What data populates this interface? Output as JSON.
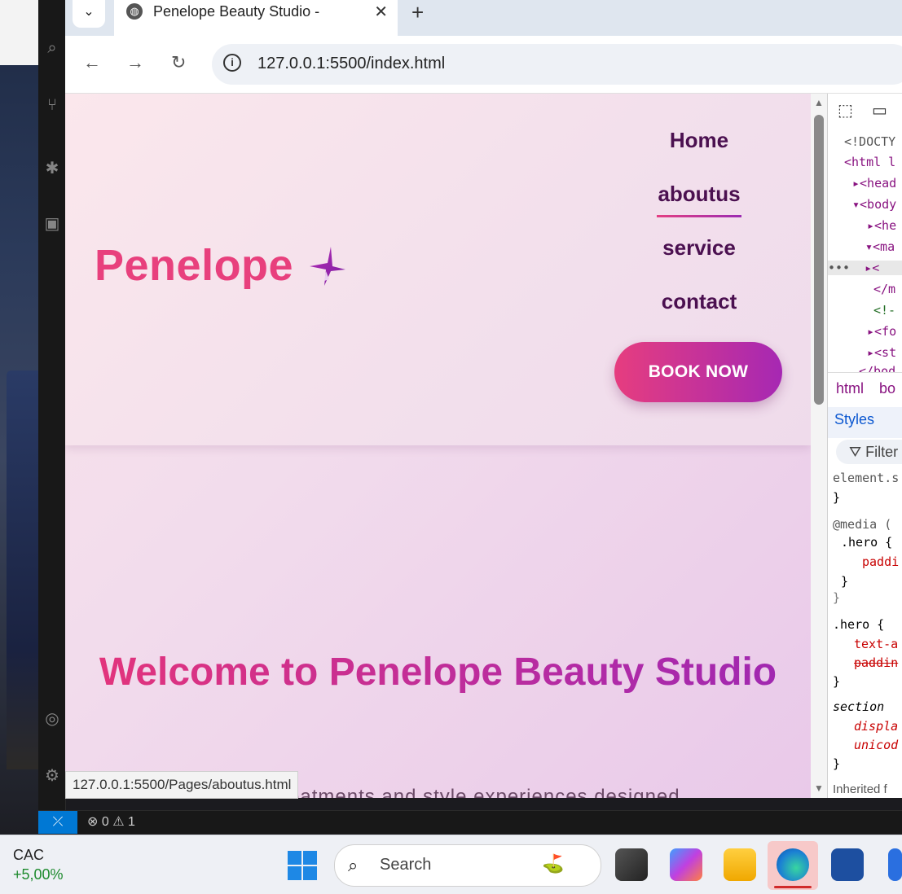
{
  "browser": {
    "tab_title": "Penelope Beauty Studio - Home",
    "url": "127.0.0.1:5500/index.html",
    "hover_link": "127.0.0.1:5500/Pages/aboutus.html"
  },
  "site": {
    "logo": "Penelope",
    "nav": [
      "Home",
      "aboutus",
      "service",
      "contact"
    ],
    "active_nav": "aboutus",
    "book_button": "BOOK NOW",
    "hero_title": "Welcome to Penelope Beauty Studio",
    "hero_text_partial": "...ntreatments and style experiences designed..."
  },
  "devtools": {
    "elements": [
      "<!DOCTY",
      "<html l",
      "<head",
      "<body",
      "<he",
      "<ma",
      "<",
      "</m",
      "<!-",
      "<fo",
      "<st",
      "</bod"
    ],
    "breadcrumb": [
      "html",
      "bo"
    ],
    "styles_tab": "Styles",
    "filter_placeholder": "Filter",
    "css_lines": [
      "element.s",
      "}",
      "@media (",
      ".hero {",
      "paddi",
      "}",
      "}",
      ".hero {",
      "text-a",
      "paddin",
      "}",
      "section",
      "displa",
      "unicod",
      "}",
      "Inherited f"
    ]
  },
  "vscode": {
    "errors": "0",
    "warnings": "1"
  },
  "taskbar": {
    "stock_name": "CAC",
    "stock_change": "+5,00%",
    "search_label": "Search"
  },
  "colors": {
    "brand_pink": "#e8407d",
    "brand_purple": "#a628b3",
    "nav_text": "#4b1050"
  }
}
